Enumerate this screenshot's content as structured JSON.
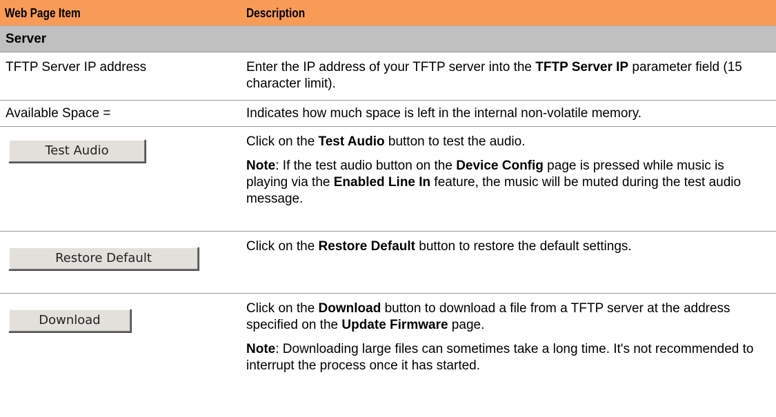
{
  "header": {
    "item": "Web Page Item",
    "description": "Description"
  },
  "section": {
    "title": "Server"
  },
  "rows": {
    "tftp": {
      "item": "TFTP Server IP address",
      "desc_1": "Enter the IP address of your TFTP server into the ",
      "desc_bold": "TFTP Server IP",
      "desc_2": " parameter field (15 character limit)."
    },
    "space": {
      "item": "Available Space =",
      "desc": "Indicates how much space is left in the internal non-volatile memory."
    },
    "test_audio": {
      "button_label": "Test Audio",
      "p1_a": "Click on the ",
      "p1_bold": "Test Audio",
      "p1_b": " button to test the audio.",
      "note_label": "Note",
      "p2_a": ": If the test audio button on the ",
      "p2_bold1": "Device Config",
      "p2_b": " page is pressed while music is playing via the ",
      "p2_bold2": "Enabled Line In",
      "p2_c": " feature, the music will be muted during the test audio message."
    },
    "restore": {
      "button_label": "Restore Default",
      "p1_a": "Click on the ",
      "p1_bold": "Restore Default",
      "p1_b": " button to restore the default settings."
    },
    "download": {
      "button_label": "Download",
      "p1_a": "Click on the ",
      "p1_bold": "Download",
      "p1_b": " button to download a file from a TFTP server at the address specified on the ",
      "p1_bold2": "Update Firmware",
      "p1_c": " page.",
      "note_label": "Note",
      "p2": ": Downloading large files can sometimes take a long time. It's not recommended to interrupt the process once it has started."
    }
  },
  "colors": {
    "header_bg": "#f79b56",
    "section_bg": "#c0c0c0",
    "button_face": "#e3e0db"
  }
}
